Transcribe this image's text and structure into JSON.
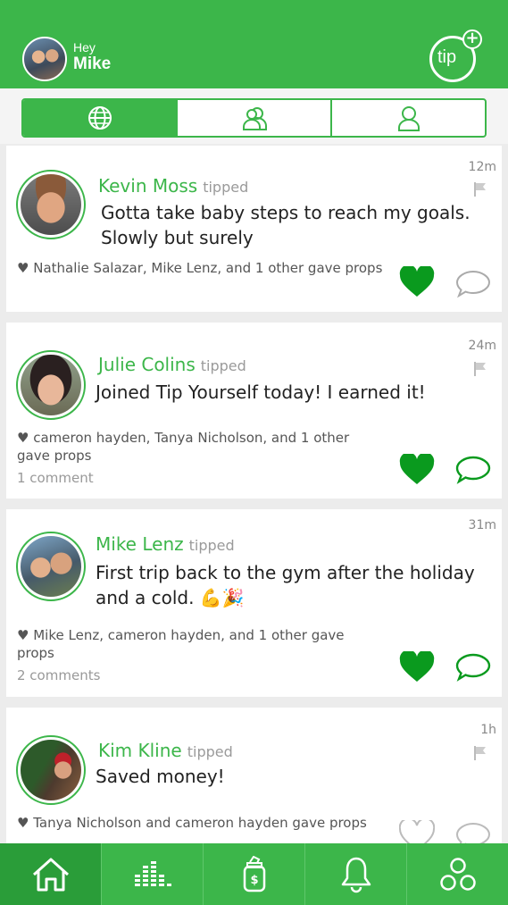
{
  "header": {
    "greeting": "Hey",
    "username": "Mike",
    "tip_button_label": "tip",
    "tip_button_plus": "+"
  },
  "tabs": [
    {
      "icon": "globe-icon",
      "active": true
    },
    {
      "icon": "friends-icon",
      "active": false
    },
    {
      "icon": "profile-icon",
      "active": false
    }
  ],
  "feed": [
    {
      "name": "Kevin Moss",
      "action": "tipped",
      "message": "Gotta take baby steps to reach my goals. Slowly but surely",
      "time": "12m",
      "props_text": "Nathalie Salazar, Mike Lenz, and 1 other gave props",
      "comments": "",
      "liked": true
    },
    {
      "name": "Julie Colins",
      "action": "tipped",
      "message": "Joined Tip Yourself today! I earned it!",
      "time": "24m",
      "props_text": "cameron hayden, Tanya Nicholson, and 1 other gave props",
      "comments": "1 comment",
      "liked": true
    },
    {
      "name": "Mike Lenz",
      "action": "tipped",
      "message": "First trip back to the gym after the holiday and a cold. 💪🎉",
      "time": "31m",
      "props_text": "Mike Lenz, cameron hayden, and 1 other gave props",
      "comments": "2 comments",
      "liked": true
    },
    {
      "name": "Kim Kline",
      "action": "tipped",
      "message": "Saved money!",
      "time": "1h",
      "props_text": "Tanya Nicholson and cameron hayden gave props",
      "comments": "",
      "liked": false
    }
  ],
  "bottom_nav": [
    {
      "icon": "home-icon",
      "active": true
    },
    {
      "icon": "leaderboard-icon",
      "active": false
    },
    {
      "icon": "money-jar-icon",
      "active": false
    },
    {
      "icon": "bell-icon",
      "active": false
    },
    {
      "icon": "more-circles-icon",
      "active": false
    }
  ],
  "colors": {
    "brand_green": "#3cb64a",
    "active_nav_green": "#2a9d39",
    "heart_filled": "#0a9a1e"
  }
}
